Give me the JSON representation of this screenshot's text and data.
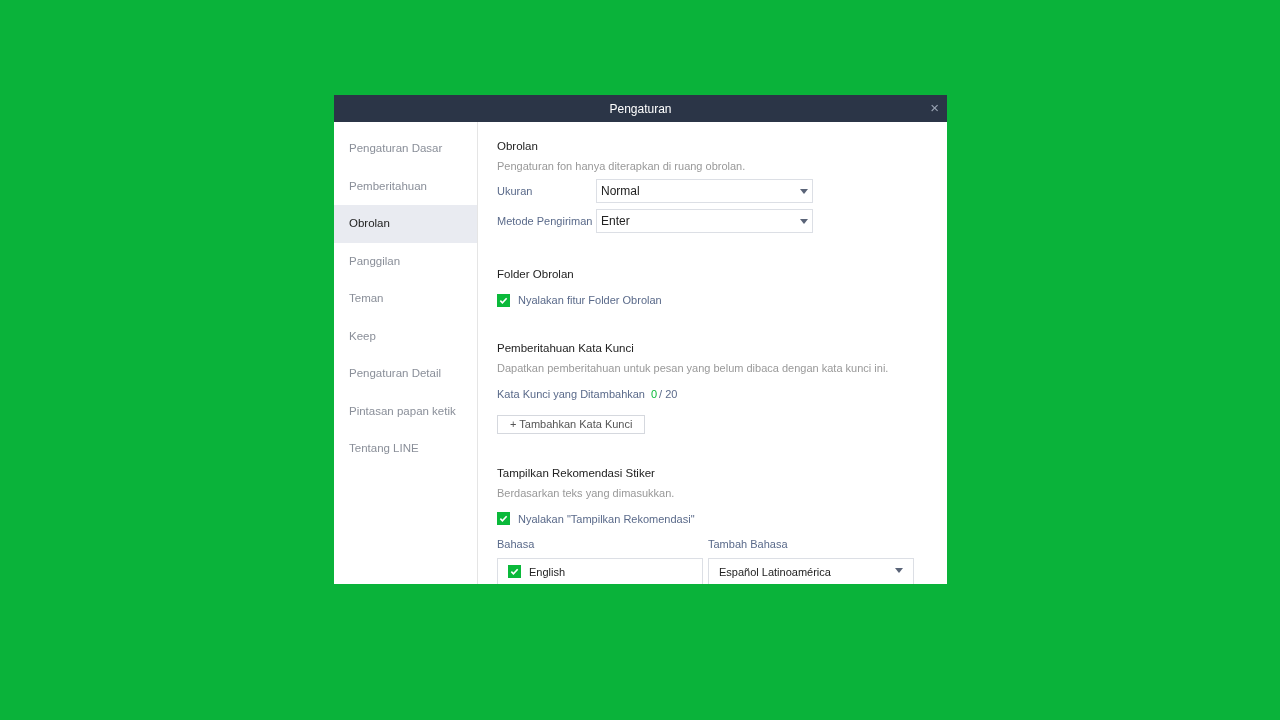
{
  "window": {
    "title": "Pengaturan",
    "close": "×"
  },
  "sidebar": {
    "items": [
      {
        "label": "Pengaturan Dasar",
        "selected": false
      },
      {
        "label": "Pemberitahuan",
        "selected": false
      },
      {
        "label": "Obrolan",
        "selected": true
      },
      {
        "label": "Panggilan",
        "selected": false
      },
      {
        "label": "Teman",
        "selected": false
      },
      {
        "label": "Keep",
        "selected": false
      },
      {
        "label": "Pengaturan Detail",
        "selected": false
      },
      {
        "label": "Pintasan papan ketik",
        "selected": false
      },
      {
        "label": "Tentang LINE",
        "selected": false
      }
    ]
  },
  "chat": {
    "title": "Obrolan",
    "description": "Pengaturan fon hanya diterapkan di ruang obrolan.",
    "fields": [
      {
        "label": "Ukuran",
        "value": "Normal"
      },
      {
        "label": "Metode Pengiriman",
        "value": "Enter"
      }
    ]
  },
  "chat_folder": {
    "title": "Folder Obrolan",
    "checkbox": {
      "label": "Nyalakan fitur Folder Obrolan",
      "checked": true
    }
  },
  "keyword_alerts": {
    "title": "Pemberitahuan Kata Kunci",
    "description": "Dapatkan pemberitahuan untuk pesan yang belum dibaca dengan kata kunci ini.",
    "count_label": "Kata Kunci yang Ditambahkan",
    "count": "0",
    "limit": "/ 20",
    "add_button": "+ Tambahkan Kata Kunci"
  },
  "sticker_suggestions": {
    "title": "Tampilkan Rekomendasi Stiker",
    "description": "Berdasarkan teks yang dimasukkan.",
    "checkbox": {
      "label": "Nyalakan \"Tampilkan Rekomendasi\"",
      "checked": true
    },
    "languages_label": "Bahasa",
    "languages": [
      {
        "label": "English",
        "checked": true
      }
    ],
    "add_language_label": "Tambah Bahasa",
    "add_language_value": "Español Latinoamérica"
  }
}
